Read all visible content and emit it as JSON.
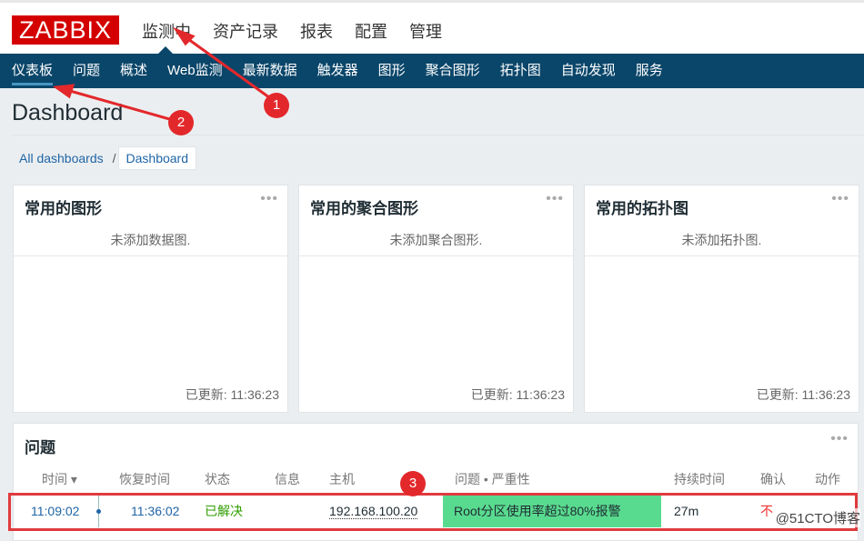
{
  "logo": "ZABBIX",
  "main_menu": [
    "监测中",
    "资产记录",
    "报表",
    "配置",
    "管理"
  ],
  "sub_menu": [
    "仪表板",
    "问题",
    "概述",
    "Web监测",
    "最新数据",
    "触发器",
    "图形",
    "聚合图形",
    "拓扑图",
    "自动发现",
    "服务"
  ],
  "page_title": "Dashboard",
  "breadcrumb": {
    "all": "All dashboards",
    "sep": "/",
    "current": "Dashboard"
  },
  "widgets": [
    {
      "title": "常用的图形",
      "empty": "未添加数据图.",
      "updated": "已更新: 11:36:23"
    },
    {
      "title": "常用的聚合图形",
      "empty": "未添加聚合图形.",
      "updated": "已更新: 11:36:23"
    },
    {
      "title": "常用的拓扑图",
      "empty": "未添加拓扑图.",
      "updated": "已更新: 11:36:23"
    }
  ],
  "problems": {
    "title": "问题",
    "columns": [
      "时间 ▾",
      "恢复时间",
      "状态",
      "信息",
      "主机",
      "问题 • 严重性",
      "持续时间",
      "确认",
      "动作"
    ],
    "rows": [
      {
        "time": "11:09:02",
        "recovery": "11:36:02",
        "status": "已解决",
        "host": "192.168.100.20",
        "problem": "Root分区使用率超过80%报警",
        "duration": "27m",
        "ack": "不"
      }
    ]
  },
  "more_icon": "•••",
  "annotations": [
    "1",
    "2",
    "3"
  ],
  "watermark": "@51CTO博客",
  "colors": {
    "nav": "#0a466a",
    "logo": "#d40000",
    "severity": "#59db8f",
    "resolved": "#2f9e00"
  }
}
